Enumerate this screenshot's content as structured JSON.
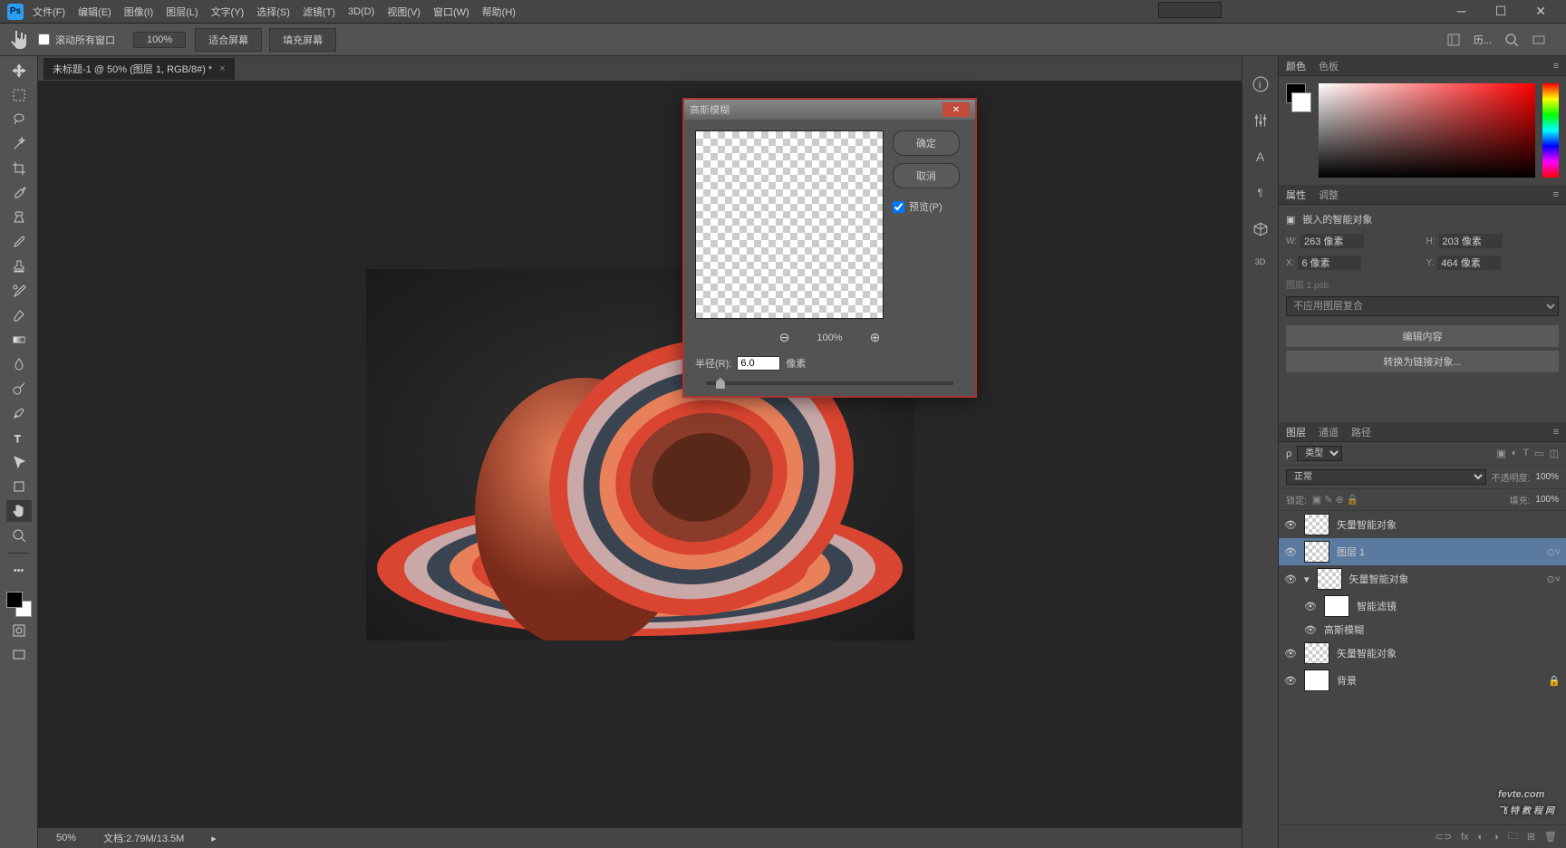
{
  "menu": {
    "items": [
      "文件(F)",
      "编辑(E)",
      "图像(I)",
      "图层(L)",
      "文字(Y)",
      "选择(S)",
      "滤镜(T)",
      "3D(D)",
      "视图(V)",
      "窗口(W)",
      "帮助(H)"
    ]
  },
  "optionsBar": {
    "scrollAll": "滚动所有窗口",
    "zoom": "100%",
    "fitScreen": "适合屏幕",
    "fillScreen": "填充屏幕",
    "history": "历..."
  },
  "docTab": {
    "title": "未标题-1 @ 50% (图层 1, RGB/8#) *"
  },
  "status": {
    "zoom": "50%",
    "docinfo": "文档:2.79M/13.5M"
  },
  "panels": {
    "colorTabs": [
      "颜色",
      "色板"
    ],
    "propTabs": [
      "属性",
      "调整"
    ],
    "smartObjLabel": "嵌入的智能对象",
    "w": {
      "lab": "W:",
      "val": "263 像素"
    },
    "h": {
      "lab": "H:",
      "val": "203 像素"
    },
    "x": {
      "lab": "X:",
      "val": "6 像素"
    },
    "y": {
      "lab": "Y:",
      "val": "464 像素"
    },
    "psbLabel": "图层 1.psb",
    "noComp": "不应用图层复合",
    "editContents": "编辑内容",
    "convertLinked": "转换为链接对象...",
    "layerTabs": [
      "图层",
      "通道",
      "路径"
    ],
    "kind": "类型",
    "blend": "正常",
    "opacityLab": "不透明度:",
    "opacityVal": "100%",
    "lockLab": "锁定:",
    "fillLab": "填充:",
    "fillVal": "100%"
  },
  "layers": [
    {
      "name": "矢量智能对象"
    },
    {
      "name": "图层 1",
      "sel": true
    },
    {
      "name": "矢量智能对象",
      "expand": true
    },
    {
      "name": "智能滤镜",
      "sub": true
    },
    {
      "name": "高斯模糊",
      "sub": true,
      "filter": true
    },
    {
      "name": "矢量智能对象"
    },
    {
      "name": "背景",
      "locked": true
    }
  ],
  "dialog": {
    "title": "高斯模糊",
    "ok": "确定",
    "cancel": "取消",
    "preview": "预览(P)",
    "zoom": "100%",
    "radiusLab": "半径(R):",
    "radiusVal": "6.0",
    "radiusUnit": "像素"
  },
  "tabwell": {
    "3d": "3D"
  },
  "watermark": {
    "main": "fevte.com",
    "sub": "飞特教程网"
  }
}
